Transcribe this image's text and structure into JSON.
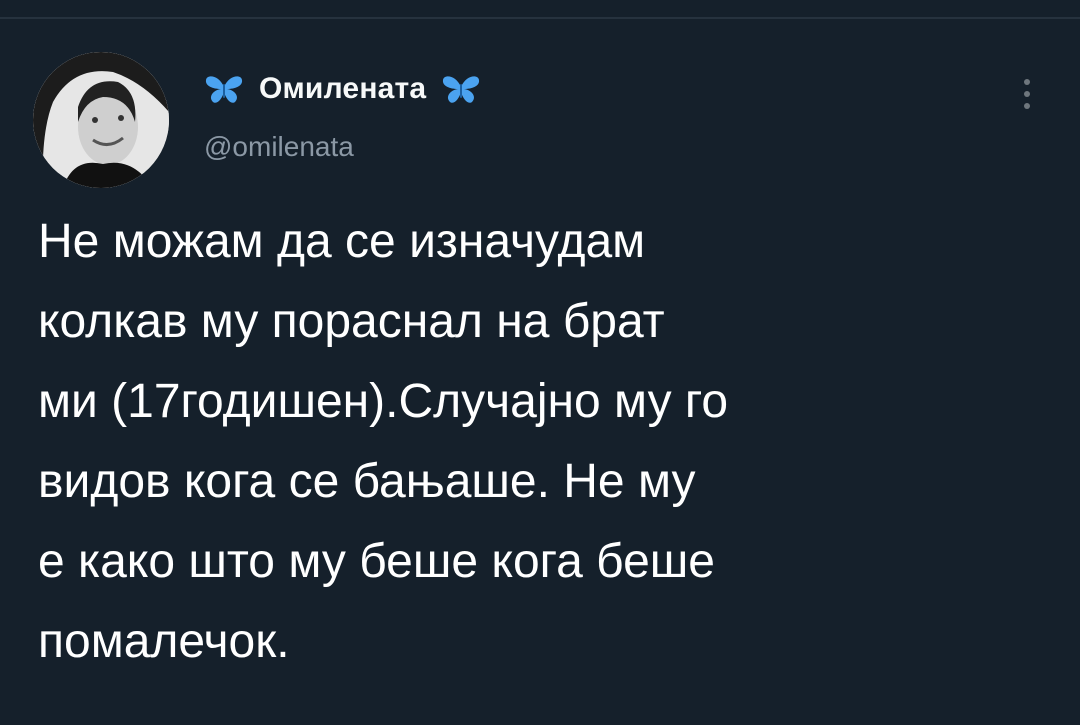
{
  "tweet": {
    "author": {
      "display_name": "Омилената",
      "handle": "@omilenata",
      "name_prefix_icon": "butterfly-emoji",
      "name_suffix_icon": "butterfly-emoji"
    },
    "text_lines": [
      "Не можам да се изначудам",
      "колкав му пораснал на брат",
      "ми (17годишен).Случајно му го",
      "видов кога се бањаше. Не му",
      "е како што му беше кога беше",
      "помалечок."
    ]
  },
  "colors": {
    "background": "#15202b",
    "text_primary": "#ffffff",
    "text_secondary": "#8b98a5",
    "butterfly": "#4ba3f0"
  }
}
